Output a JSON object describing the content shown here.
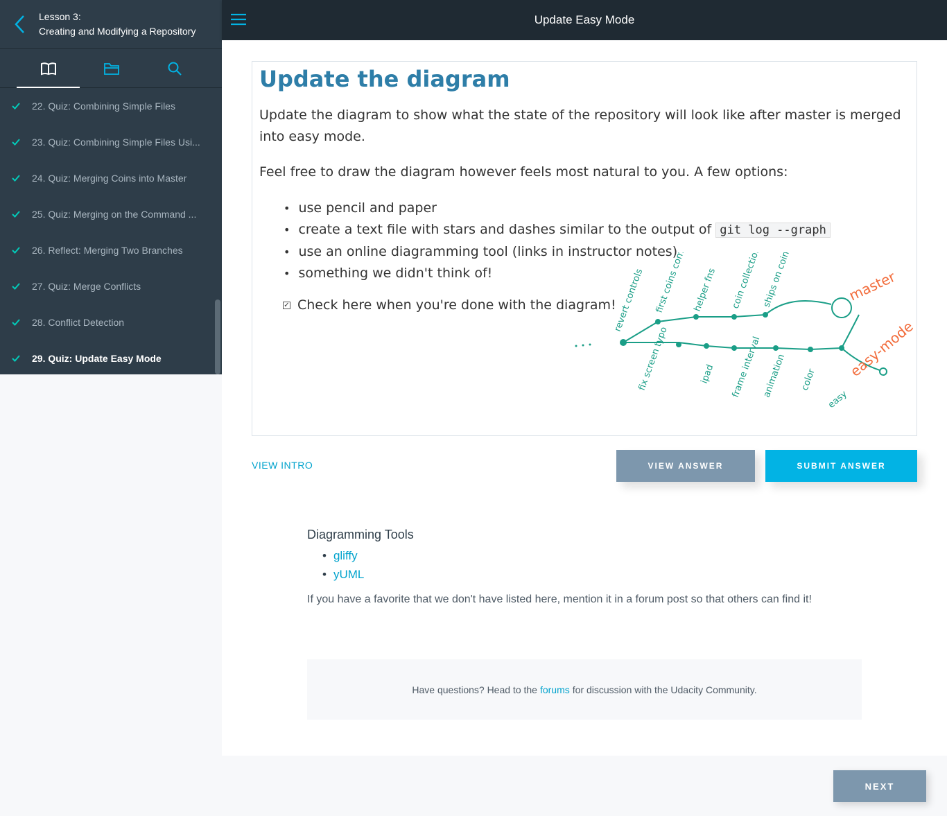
{
  "sidebar": {
    "lesson_number": "Lesson 3:",
    "lesson_title": "Creating and Modifying a Repository",
    "items": [
      {
        "label": "22. Quiz: Combining Simple Files"
      },
      {
        "label": "23. Quiz: Combining Simple Files Usi..."
      },
      {
        "label": "24. Quiz: Merging Coins into Master"
      },
      {
        "label": "25. Quiz: Merging on the Command ..."
      },
      {
        "label": "26. Reflect: Merging Two Branches"
      },
      {
        "label": "27. Quiz: Merge Conflicts"
      },
      {
        "label": "28. Conflict Detection"
      },
      {
        "label": "29. Quiz: Update Easy Mode"
      }
    ]
  },
  "header": {
    "title": "Update Easy Mode"
  },
  "quiz": {
    "title": "Update the diagram",
    "p1": "Update the diagram to show what the state of the repository will look like after master is merged into easy mode.",
    "p2": "Feel free to draw the diagram however feels most natural to you. A few options:",
    "options": [
      "use pencil and paper",
      "create a text file with stars and dashes similar to the output of",
      "use an online diagramming tool (links in instructor notes)",
      "something we didn't think of!"
    ],
    "code": "git log --graph",
    "check_label": "Check here when you're done with the diagram!",
    "diagram_labels": {
      "master": "master",
      "easy_mode": "easy-mode",
      "commits_top": [
        "revert controls",
        "first coins commit",
        "helper fns",
        "coin collection",
        "ships on coins"
      ],
      "commits_bottom": [
        "fix screen typo",
        "ipad",
        "frame interval",
        "animation",
        "color",
        "easy"
      ]
    }
  },
  "actions": {
    "view_intro": "VIEW INTRO",
    "view_answer": "VIEW ANSWER",
    "submit_answer": "SUBMIT ANSWER",
    "next": "NEXT"
  },
  "notes": {
    "heading": "Diagramming Tools",
    "links": [
      "gliffy",
      "yUML"
    ],
    "text": "If you have a favorite that we don't have listed here, mention it in a forum post so that others can find it!"
  },
  "forum": {
    "before": "Have questions? Head to the",
    "link": "forums",
    "after": "for discussion with the Udacity Community."
  },
  "colors": {
    "accent": "#02b3e4",
    "sidebar": "#2e3d49",
    "topbar": "#1f2a33",
    "check": "#02ccba",
    "diagram_green": "#1a9e87",
    "diagram_orange": "#f26b3a"
  }
}
